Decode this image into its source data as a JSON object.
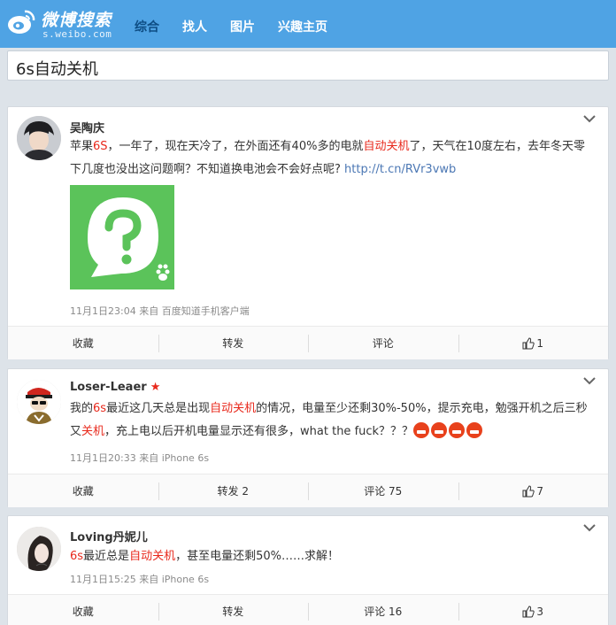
{
  "header": {
    "logo_cn": "微博搜索",
    "logo_url_text": "s.weibo.com",
    "nav": [
      "综合",
      "找人",
      "图片",
      "兴趣主页"
    ],
    "active_nav": "综合"
  },
  "search": {
    "query": "6s自动关机"
  },
  "colors": {
    "brand": "#4fa3e4",
    "highlight": "#e8291c",
    "link": "#4b77b4"
  },
  "posts": [
    {
      "user": "吴陶庆",
      "text_parts": [
        "苹果",
        "6S",
        "，一年了，现在天冷了，在外面还有40%多的电就",
        "自动关机",
        "了，天气在10度左右，去年冬天零下几度也没出这问题啊？不知道换电池会不会好点呢? "
      ],
      "link": "http://t.cn/RVr3vwb",
      "meta": "11月1日23:04 来自 百度知道手机客户端",
      "actions": {
        "favorite": "收藏",
        "repost": "转发",
        "comment": "评论",
        "like": "1"
      }
    },
    {
      "user": "Loser-Leaer",
      "text_parts": [
        "我的",
        "6s",
        "最近这几天总是出现",
        "自动关机",
        "的情况，电量至少还剩30%-50%，提示充电，勉强开机之后三秒又",
        "关机",
        "，充上电以后开机电量显示还有很多，what the fuck？？？"
      ],
      "meta": "11月1日20:33 来自 iPhone 6s",
      "actions": {
        "favorite": "收藏",
        "repost": "转发 2",
        "comment": "评论 75",
        "like": "7"
      }
    },
    {
      "user": "Loving丹妮儿",
      "text_parts": [
        "6s",
        "最近总是",
        "自动关机",
        "，甚至电量还剩50%……求解！"
      ],
      "meta": "11月1日15:25 来自 iPhone 6s",
      "actions": {
        "favorite": "收藏",
        "repost": "转发",
        "comment": "评论 16",
        "like": "3"
      }
    }
  ]
}
